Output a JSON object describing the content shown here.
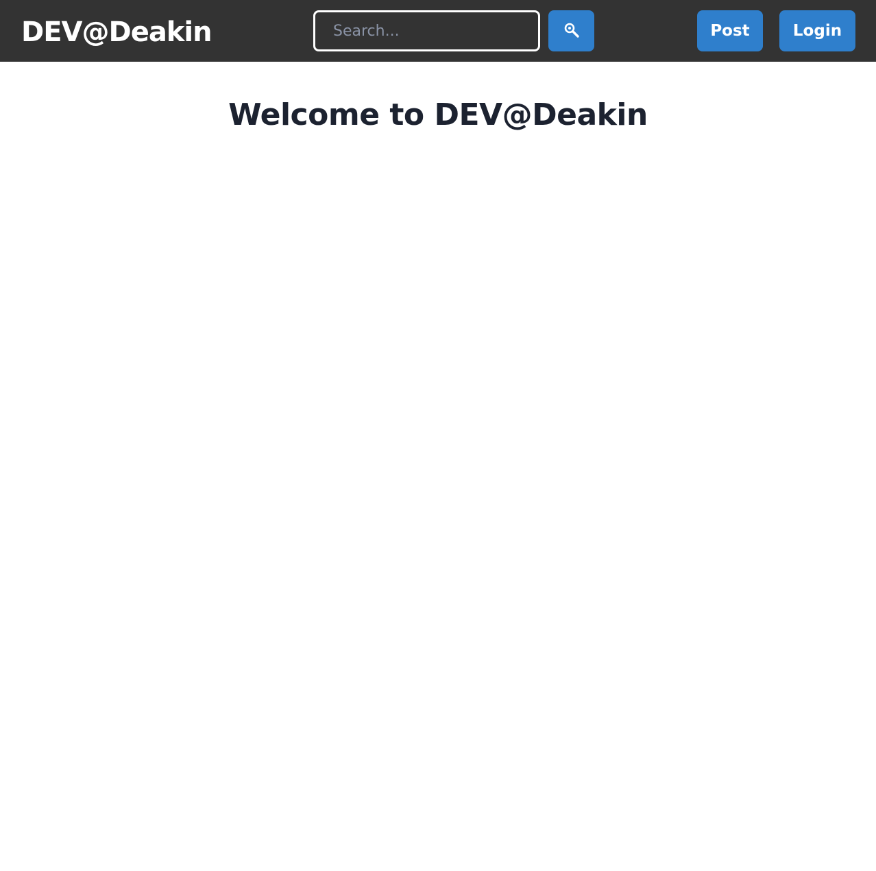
{
  "navbar": {
    "brand": "DEV@Deakin",
    "search": {
      "placeholder": "Search...",
      "value": "",
      "button_icon": "search-icon"
    },
    "post_label": "Post",
    "login_label": "Login"
  },
  "main": {
    "title": "Welcome to DEV@Deakin"
  },
  "colors": {
    "navbar_bg": "#333333",
    "accent": "#2f7fcc",
    "title_text": "#1c2230"
  }
}
